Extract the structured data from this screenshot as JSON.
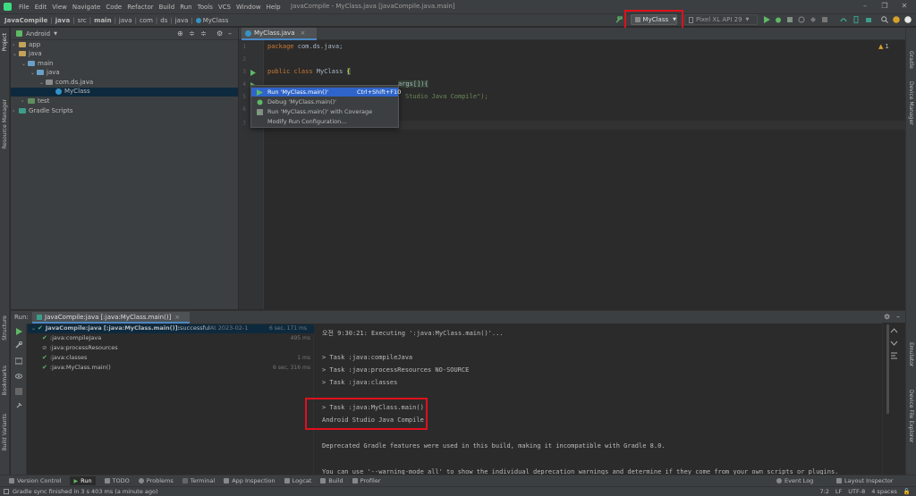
{
  "menu": [
    "File",
    "Edit",
    "View",
    "Navigate",
    "Code",
    "Refactor",
    "Build",
    "Run",
    "Tools",
    "VCS",
    "Window",
    "Help"
  ],
  "window_title": "JavaCompile - MyClass.java [JavaCompile.java.main]",
  "breadcrumb": [
    "JavaCompile",
    "java",
    "src",
    "main",
    "java",
    "com",
    "ds",
    "java",
    "MyClass"
  ],
  "toolbar": {
    "run_config": "MyClass",
    "device": "Pixel XL API 29"
  },
  "project": {
    "view_selector": "Android",
    "tree": [
      {
        "label": "app",
        "depth": 0
      },
      {
        "label": "java",
        "depth": 0
      },
      {
        "label": "main",
        "depth": 1
      },
      {
        "label": "java",
        "depth": 2
      },
      {
        "label": "com.ds.java",
        "depth": 3
      },
      {
        "label": "MyClass",
        "depth": 4
      },
      {
        "label": "test",
        "depth": 1
      },
      {
        "label": "Gradle Scripts",
        "depth": 0
      }
    ]
  },
  "left_stripe": {
    "project": "Project",
    "resource_manager": "Resource Manager",
    "structure": "Structure",
    "bookmarks": "Bookmarks",
    "build_variants": "Build Variants"
  },
  "right_stripe": {
    "gradle": "Gradle",
    "device_manager": "Device Manager",
    "emulator": "Emulator",
    "device_file_explorer": "Device File Explorer"
  },
  "editor": {
    "tab": "MyClass.java",
    "warning_count": "1",
    "lines": [
      {
        "n": "1",
        "text": "package com.ds.java;"
      },
      {
        "n": "2",
        "text": ""
      },
      {
        "n": "3",
        "text": "public class MyClass {"
      },
      {
        "n": "4",
        "text": "args[]){"
      },
      {
        "n": "5",
        "text": "Studio Java Compile\");"
      },
      {
        "n": "6",
        "text": ""
      },
      {
        "n": "7",
        "text": ""
      }
    ],
    "line1_kw": "package",
    "line1_rest": " com.ds.java;",
    "line3_kw": "public class",
    "line3_rest": " MyClass ",
    "line3_brace": "{"
  },
  "popup": {
    "items": [
      {
        "label": "Run 'MyClass.main()'",
        "shortcut": "Ctrl+Shift+F10"
      },
      {
        "label": "Debug 'MyClass.main()'",
        "shortcut": ""
      },
      {
        "label": "Run 'MyClass.main()' with Coverage",
        "shortcut": ""
      },
      {
        "label": "Modify Run Configuration...",
        "shortcut": ""
      }
    ]
  },
  "run": {
    "label": "Run:",
    "tab": "JavaCompile:java [:java:MyClass.main()]",
    "tree": [
      {
        "label": "JavaCompile:java [:java:MyClass.main()]:",
        "status": " successful",
        "extra": " At 2023-02-1",
        "time": "6 sec, 171 ms"
      },
      {
        "label": ":java:compileJava",
        "time": "495 ms"
      },
      {
        "label": ":java:processResources",
        "time": ""
      },
      {
        "label": ":java:classes",
        "time": "1 ms"
      },
      {
        "label": ":java:MyClass.main()",
        "time": "6 sec, 316 ms"
      }
    ],
    "console": [
      "오전 9:30:21: Executing ':java:MyClass.main()'...",
      "",
      "",
      "> Task :java:compileJava",
      "> Task :java:processResources NO-SOURCE",
      "> Task :java:classes",
      "",
      "> Task :java:MyClass.main()",
      "Android Studio Java Compile",
      "",
      "Deprecated Gradle features were used in this build, making it incompatible with Gradle 8.0.",
      "",
      "You can use '--warning-mode all' to show the individual deprecation warnings and determine if they come from your own scripts or plugins."
    ]
  },
  "bottom_tools": [
    "Version Control",
    "Run",
    "TODO",
    "Problems",
    "Terminal",
    "App Inspection",
    "Logcat",
    "Build",
    "Profiler"
  ],
  "bottom_right": [
    "Event Log",
    "Layout Inspector"
  ],
  "status": {
    "message": "Gradle sync finished in 3 s 403 ms (a minute ago)",
    "position": "7:2",
    "line_sep": "LF",
    "encoding": "UTF-8",
    "indent": "4 spaces"
  }
}
